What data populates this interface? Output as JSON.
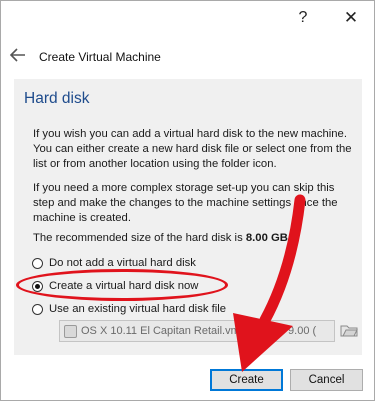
{
  "window": {
    "help_glyph": "?",
    "close_glyph": "✕"
  },
  "wizard": {
    "title": "Create Virtual Machine",
    "page_title": "Hard disk",
    "paragraph1": "If you wish you can add a virtual hard disk to the new machine. You can either create a new hard disk file or select one from the list or from another location using the folder icon.",
    "paragraph2": "If you need a more complex storage set-up you can skip this step and make the changes to the machine settings once the machine is created.",
    "recommend_prefix": "The recommended size of the hard disk is ",
    "recommend_size": "8.00 GB",
    "recommend_suffix": ".",
    "options": [
      {
        "label": "Do not add a virtual hard disk",
        "checked": false
      },
      {
        "label": "Create a virtual hard disk now",
        "checked": true
      },
      {
        "label": "Use an existing virtual hard disk file",
        "checked": false
      }
    ],
    "disk_select_value": "OS X 10.11 El Capitan Retail.vmdk (N",
    "disk_select_value_tail": "9.00 (",
    "buttons": {
      "create": "Create",
      "cancel": "Cancel"
    }
  },
  "colors": {
    "accent": "#1e4b8c",
    "annotation_red": "#e0131c",
    "focus_blue": "#0078d7"
  },
  "icons": [
    "help-icon",
    "close-icon",
    "back-arrow-icon",
    "hard-disk-icon",
    "folder-icon"
  ]
}
